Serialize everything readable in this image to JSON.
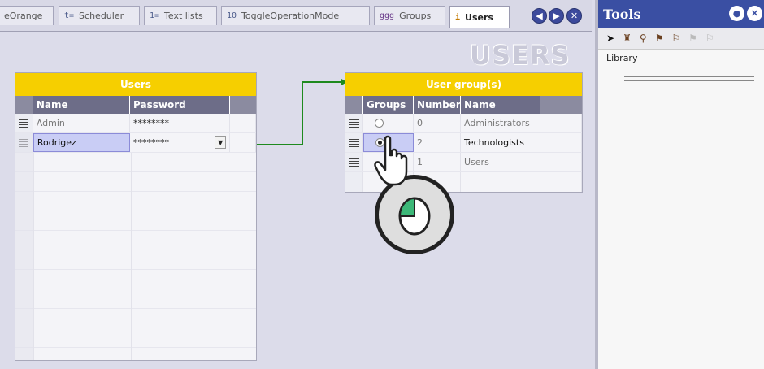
{
  "tabs": [
    {
      "label": "eOrange",
      "icon": ""
    },
    {
      "label": "Scheduler",
      "icon": "t="
    },
    {
      "label": "Text lists",
      "icon": "1="
    },
    {
      "label": "ToggleOperationMode",
      "icon": "10"
    },
    {
      "label": "Groups",
      "icon": "ggg"
    },
    {
      "label": "Users",
      "icon": "i"
    }
  ],
  "nav_icons": [
    "prev-icon",
    "next-icon",
    "close-icon"
  ],
  "page_big_title": "USERS",
  "users_table": {
    "title": "Users",
    "columns": [
      "Name",
      "Password"
    ],
    "rows": [
      {
        "name": "Admin",
        "password": "********"
      },
      {
        "name": "Rodrigez",
        "password": "********"
      }
    ]
  },
  "groups_table": {
    "title": "User group(s)",
    "columns": [
      "Groups",
      "Number",
      "Name"
    ],
    "rows": [
      {
        "selected": false,
        "number": "0",
        "name": "Administrators"
      },
      {
        "selected": true,
        "number": "2",
        "name": "Technologists"
      },
      {
        "selected": false,
        "number": "1",
        "name": "Users"
      }
    ]
  },
  "tools": {
    "title": "Tools",
    "library_label": "Library"
  },
  "colors": {
    "header_yellow": "#f6cf00",
    "column_header": "#6d6d88",
    "tools_blue": "#3a4fa3",
    "link_green": "#1e8a1e"
  }
}
